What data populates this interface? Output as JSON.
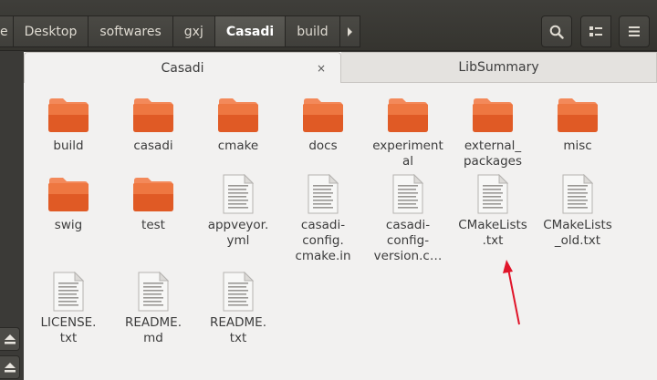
{
  "pathbar": {
    "crumbs": [
      "e",
      "Desktop",
      "softwares",
      "gxj",
      "Casadi",
      "build"
    ],
    "active_index": 4
  },
  "tabs": [
    {
      "label": "Casadi",
      "close": "×"
    },
    {
      "label": "LibSummary"
    }
  ],
  "icons": {
    "folder": "folder-icon",
    "text_file": "text-file-icon",
    "search": "search-icon",
    "view": "list-view-icon",
    "menu": "hamburger-menu-icon",
    "eject": "eject-icon",
    "next": "chevron-right-icon"
  },
  "colors": {
    "folder_top": "#f3895a",
    "folder_body": "#e05a25",
    "annotation_arrow": "#e0152a"
  },
  "files": [
    {
      "name": "build",
      "lines": [
        "build"
      ],
      "type": "folder"
    },
    {
      "name": "casadi",
      "lines": [
        "casadi"
      ],
      "type": "folder"
    },
    {
      "name": "cmake",
      "lines": [
        "cmake"
      ],
      "type": "folder"
    },
    {
      "name": "docs",
      "lines": [
        "docs"
      ],
      "type": "folder"
    },
    {
      "name": "experimental",
      "lines": [
        "experiment",
        "al"
      ],
      "type": "folder"
    },
    {
      "name": "external_packages",
      "lines": [
        "external_",
        "packages"
      ],
      "type": "folder"
    },
    {
      "name": "misc",
      "lines": [
        "misc"
      ],
      "type": "folder"
    },
    {
      "name": "swig",
      "lines": [
        "swig"
      ],
      "type": "folder"
    },
    {
      "name": "test",
      "lines": [
        "test"
      ],
      "type": "folder"
    },
    {
      "name": "appveyor.yml",
      "lines": [
        "appveyor.",
        "yml"
      ],
      "type": "text"
    },
    {
      "name": "casadi-config.cmake.in",
      "lines": [
        "casadi-",
        "config.",
        "cmake.in"
      ],
      "type": "text"
    },
    {
      "name": "casadi-config-version.cmake",
      "lines": [
        "casadi-",
        "config-",
        "version.c…"
      ],
      "type": "text"
    },
    {
      "name": "CMakeLists.txt",
      "lines": [
        "CMakeLists",
        ".txt"
      ],
      "type": "text"
    },
    {
      "name": "CMakeLists_old.txt",
      "lines": [
        "CMakeLists",
        "_old.txt"
      ],
      "type": "text"
    },
    {
      "name": "LICENSE.txt",
      "lines": [
        "LICENSE.",
        "txt"
      ],
      "type": "text"
    },
    {
      "name": "README.md",
      "lines": [
        "README.",
        "md"
      ],
      "type": "text"
    },
    {
      "name": "README.txt",
      "lines": [
        "README.",
        "txt"
      ],
      "type": "text"
    }
  ]
}
